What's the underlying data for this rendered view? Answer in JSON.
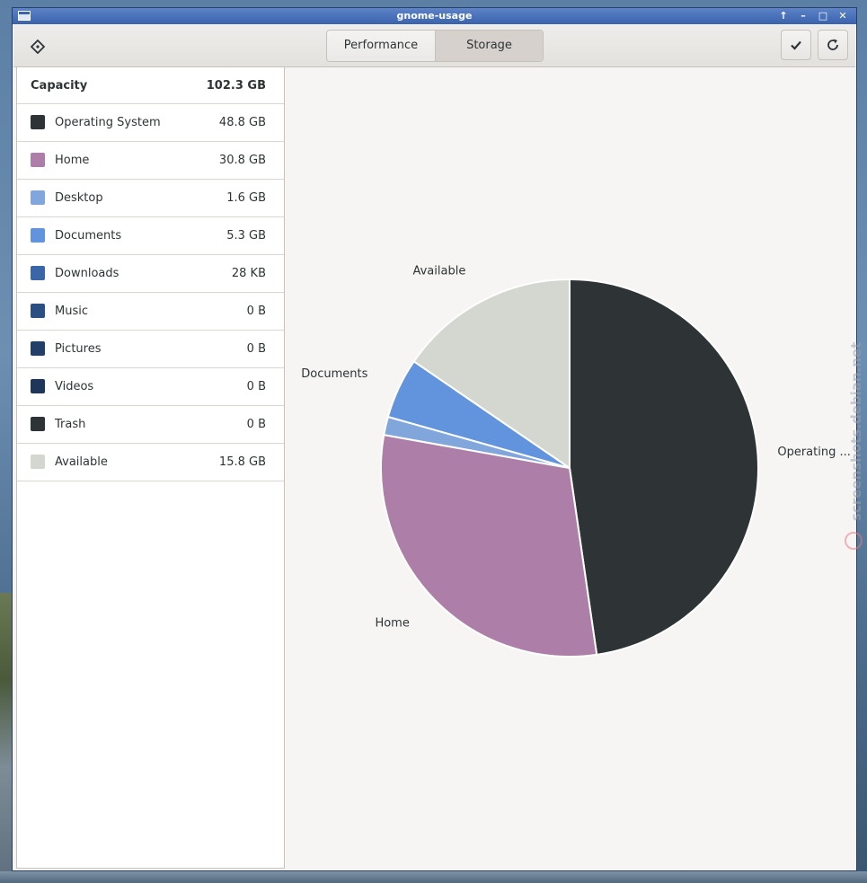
{
  "window": {
    "title": "gnome-usage"
  },
  "header": {
    "tabs": [
      {
        "label": "Performance",
        "active": false
      },
      {
        "label": "Storage",
        "active": true
      }
    ]
  },
  "sidebar": {
    "capacity": {
      "label": "Capacity",
      "value": "102.3 GB"
    },
    "items": [
      {
        "label": "Operating System",
        "value": "48.8 GB",
        "color": "#2e3436"
      },
      {
        "label": "Home",
        "value": "30.8 GB",
        "color": "#ad7fa8"
      },
      {
        "label": "Desktop",
        "value": "1.6 GB",
        "color": "#81a6dc"
      },
      {
        "label": "Documents",
        "value": "5.3 GB",
        "color": "#6194dd"
      },
      {
        "label": "Downloads",
        "value": "28 KB",
        "color": "#3a65a6"
      },
      {
        "label": "Music",
        "value": "0 B",
        "color": "#2c4f82"
      },
      {
        "label": "Pictures",
        "value": "0 B",
        "color": "#233f68"
      },
      {
        "label": "Videos",
        "value": "0 B",
        "color": "#1f3659"
      },
      {
        "label": "Trash",
        "value": "0 B",
        "color": "#2e3436"
      },
      {
        "label": "Available",
        "value": "15.8 GB",
        "color": "#d3d7cf"
      }
    ]
  },
  "chart_data": {
    "type": "pie",
    "total": 102.3,
    "unit": "GB",
    "slices": [
      {
        "name": "Operating System",
        "value": 48.8,
        "color": "#2e3436",
        "label": "Operating ..."
      },
      {
        "name": "Home",
        "value": 30.8,
        "color": "#ad7fa8",
        "label": "Home"
      },
      {
        "name": "Desktop",
        "value": 1.6,
        "color": "#81a6dc",
        "label": ""
      },
      {
        "name": "Documents",
        "value": 5.3,
        "color": "#6194dd",
        "label": "Documents"
      },
      {
        "name": "Available",
        "value": 15.8,
        "color": "#d3d7cf",
        "label": "Available"
      }
    ]
  },
  "watermark": {
    "text": "screenshots.debian.net"
  }
}
